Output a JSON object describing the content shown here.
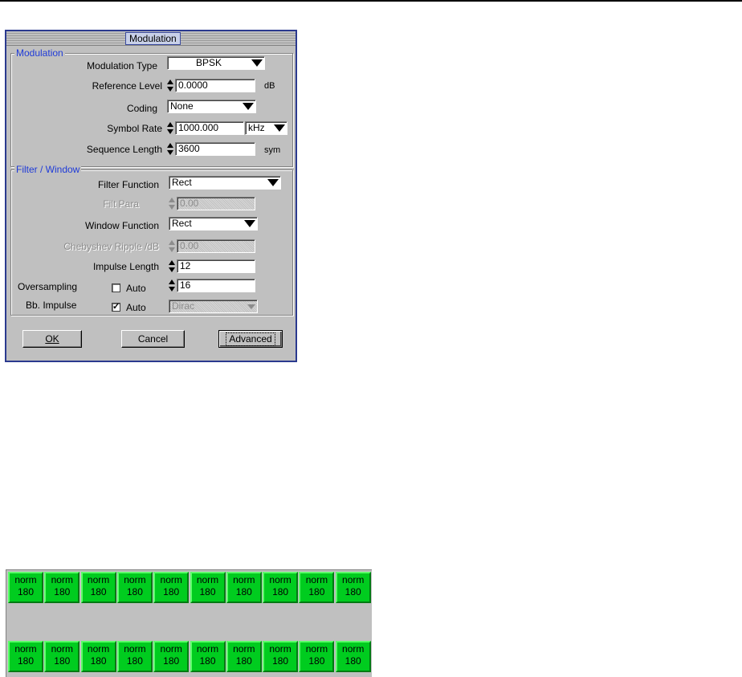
{
  "dialog": {
    "title": "Modulation",
    "modulation_group": {
      "title": "Modulation",
      "modulation_type": {
        "label": "Modulation Type",
        "value": "BPSK"
      },
      "reference_level": {
        "label": "Reference Level",
        "value": "0.0000",
        "unit": "dB"
      },
      "coding": {
        "label": "Coding",
        "value": "None"
      },
      "symbol_rate": {
        "label": "Symbol  Rate",
        "value": "1000.000",
        "unit": "kHz"
      },
      "sequence_length": {
        "label": "Sequence Length",
        "value": "3600",
        "unit": "sym"
      }
    },
    "filter_group": {
      "title": "Filter / Window",
      "filter_function": {
        "label": "Filter Function",
        "value": "Rect"
      },
      "filt_para": {
        "label": "Filt Para",
        "value": "0.00"
      },
      "window_function": {
        "label": "Window Function",
        "value": "Rect"
      },
      "chebyshev_ripple": {
        "label": "Chebyshev Ripple /dB",
        "value": "0.00"
      },
      "impulse_length": {
        "label": "Impulse Length",
        "value": "12"
      },
      "oversampling": {
        "label": "Oversampling",
        "auto_label": "Auto",
        "auto_checked": false,
        "value": "16"
      },
      "bb_impulse": {
        "label": "Bb. Impulse",
        "auto_label": "Auto",
        "auto_checked": true,
        "value": "Dirac"
      }
    },
    "buttons": {
      "ok": "OK",
      "cancel": "Cancel",
      "advanced": "Advanced"
    }
  },
  "status_panel": {
    "cell_color": "#00cc1f",
    "rows": [
      [
        {
          "line1": "norm",
          "line2": "180"
        },
        {
          "line1": "norm",
          "line2": "180"
        },
        {
          "line1": "norm",
          "line2": "180"
        },
        {
          "line1": "norm",
          "line2": "180"
        },
        {
          "line1": "norm",
          "line2": "180"
        },
        {
          "line1": "norm",
          "line2": "180"
        },
        {
          "line1": "norm",
          "line2": "180"
        },
        {
          "line1": "norm",
          "line2": "180"
        },
        {
          "line1": "norm",
          "line2": "180"
        },
        {
          "line1": "norm",
          "line2": "180"
        }
      ],
      [
        {
          "line1": "norm",
          "line2": "180"
        },
        {
          "line1": "norm",
          "line2": "180"
        },
        {
          "line1": "norm",
          "line2": "180"
        },
        {
          "line1": "norm",
          "line2": "180"
        },
        {
          "line1": "norm",
          "line2": "180"
        },
        {
          "line1": "norm",
          "line2": "180"
        },
        {
          "line1": "norm",
          "line2": "180"
        },
        {
          "line1": "norm",
          "line2": "180"
        },
        {
          "line1": "norm",
          "line2": "180"
        },
        {
          "line1": "norm",
          "line2": "180"
        }
      ]
    ]
  }
}
